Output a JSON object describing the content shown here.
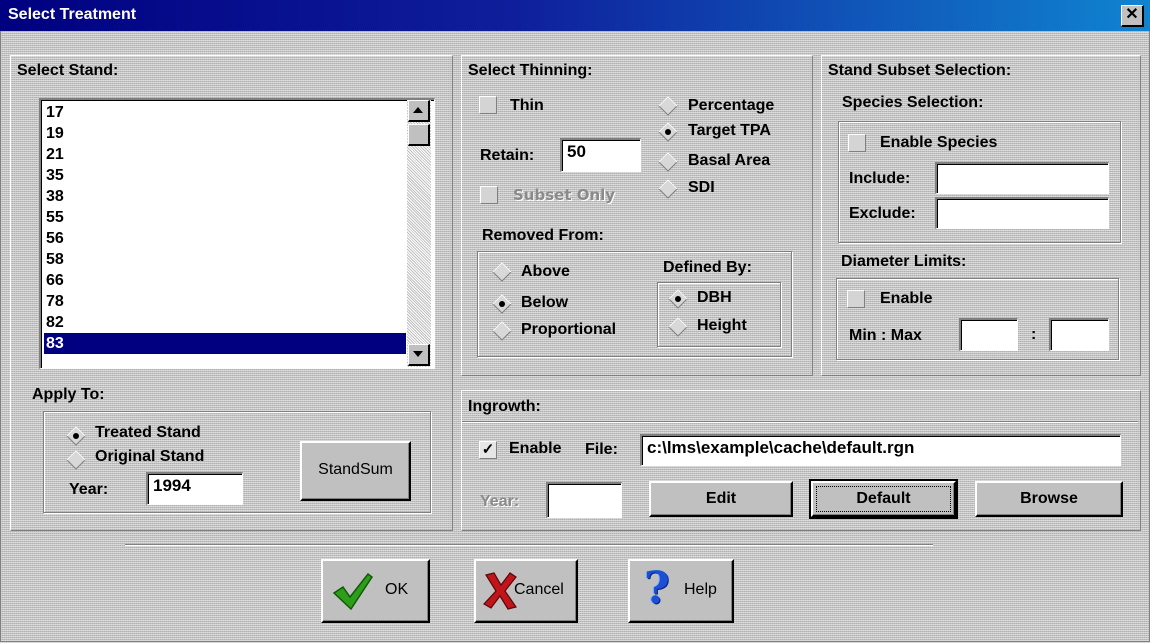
{
  "window": {
    "title": "Select Treatment",
    "close_symbol": "✕"
  },
  "select_stand": {
    "header": "Select Stand:",
    "stands": [
      "17",
      "19",
      "21",
      "35",
      "38",
      "55",
      "56",
      "58",
      "66",
      "78",
      "82",
      "83"
    ],
    "selected": "83",
    "apply_to": {
      "header": "Apply To:",
      "options": [
        "Treated Stand",
        "Original Stand"
      ],
      "selected": "Treated Stand",
      "year_label": "Year:",
      "year_value": "1994",
      "standsum_label": "StandSum"
    }
  },
  "select_thinning": {
    "header": "Select Thinning:",
    "thin_label": "Thin",
    "thin_checked": false,
    "retain_label": "Retain:",
    "retain_value": "50",
    "subset_only_label": "Subset Only",
    "methods": [
      "Percentage",
      "Target TPA",
      "Basal Area",
      "SDI"
    ],
    "method_selected": "Target TPA",
    "removed_from": {
      "header": "Removed From:",
      "options": [
        "Above",
        "Below",
        "Proportional"
      ],
      "selected": "Below"
    },
    "defined_by": {
      "header": "Defined By:",
      "options": [
        "DBH",
        "Height"
      ],
      "selected": "DBH"
    }
  },
  "stand_subset": {
    "header": "Stand Subset Selection:",
    "species": {
      "header": "Species Selection:",
      "enable_label": "Enable Species",
      "enabled": false,
      "include_label": "Include:",
      "include_value": "",
      "exclude_label": "Exclude:",
      "exclude_value": ""
    },
    "diameter": {
      "header": "Diameter Limits:",
      "enable_label": "Enable",
      "enabled": false,
      "minmax_label": "Min : Max",
      "colon": ":",
      "min_value": "",
      "max_value": ""
    }
  },
  "ingrowth": {
    "header": "Ingrowth:",
    "enable_label": "Enable",
    "enabled": true,
    "check_mark": "✓",
    "file_label": "File:",
    "file_value": "c:\\lms\\example\\cache\\default.rgn",
    "year_label": "Year:",
    "year_value": "",
    "edit_label": "Edit",
    "default_label": "Default",
    "browse_label": "Browse"
  },
  "footer": {
    "ok_label": "OK",
    "cancel_label": "Cancel",
    "help_label": "Help",
    "help_symbol": "?"
  },
  "colors": {
    "title_start": "#000080",
    "title_end": "#1084d0",
    "selection": "#000080",
    "ok_check": "#2e9e1a",
    "cancel_x": "#c0151a",
    "help_q": "#1a4fd6"
  }
}
